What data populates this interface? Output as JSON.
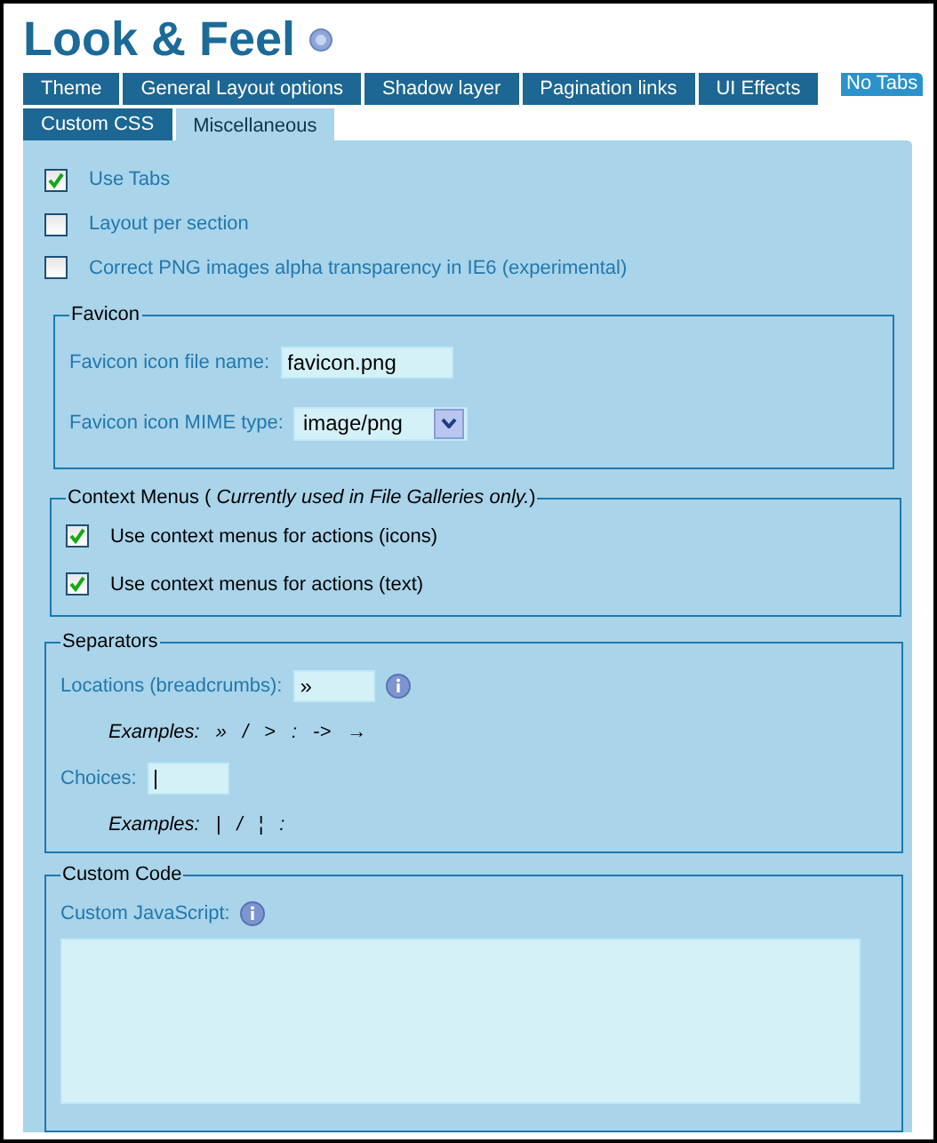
{
  "title": "Look & Feel",
  "tabs": [
    {
      "label": "Theme",
      "selected": false
    },
    {
      "label": "General Layout options",
      "selected": false
    },
    {
      "label": "Shadow layer",
      "selected": false
    },
    {
      "label": "Pagination links",
      "selected": false
    },
    {
      "label": "UI Effects",
      "selected": false
    },
    {
      "label": "Custom CSS",
      "selected": false
    },
    {
      "label": "Miscellaneous",
      "selected": true
    }
  ],
  "no_tabs_button": "No Tabs",
  "options": [
    {
      "label": "Use Tabs",
      "checked": true
    },
    {
      "label": "Layout per section",
      "checked": false
    },
    {
      "label": "Correct PNG images alpha transparency in IE6 (experimental)",
      "checked": false
    }
  ],
  "favicon": {
    "legend": "Favicon",
    "fields": [
      {
        "kind": "text",
        "label": "Favicon icon file name:",
        "value": "favicon.png"
      },
      {
        "kind": "select",
        "label": "Favicon icon MIME type:",
        "value": "image/png"
      }
    ]
  },
  "context_menus": {
    "legend": "Context Menus ( *Currently used in File Galleries only.*)",
    "options": [
      {
        "label": "Use context menus for actions (icons)",
        "checked": true
      },
      {
        "label": "Use context menus for actions (text)",
        "checked": true
      }
    ]
  },
  "separators": {
    "legend": "Separators",
    "fields": [
      {
        "label": "Locations (breadcrumbs):",
        "value": "»",
        "focused": false,
        "help": true,
        "examples_label": "Examples:",
        "examples": [
          "»",
          "/",
          ">",
          ":",
          "->",
          "→"
        ]
      },
      {
        "label": "Choices:",
        "focused": true,
        "help": false,
        "examples_label": "Examples:",
        "examples": [
          "|",
          "/",
          "¦",
          ":"
        ]
      }
    ]
  },
  "custom_code": {
    "legend": "Custom Code",
    "label": "Custom JavaScript:",
    "help": true
  }
}
